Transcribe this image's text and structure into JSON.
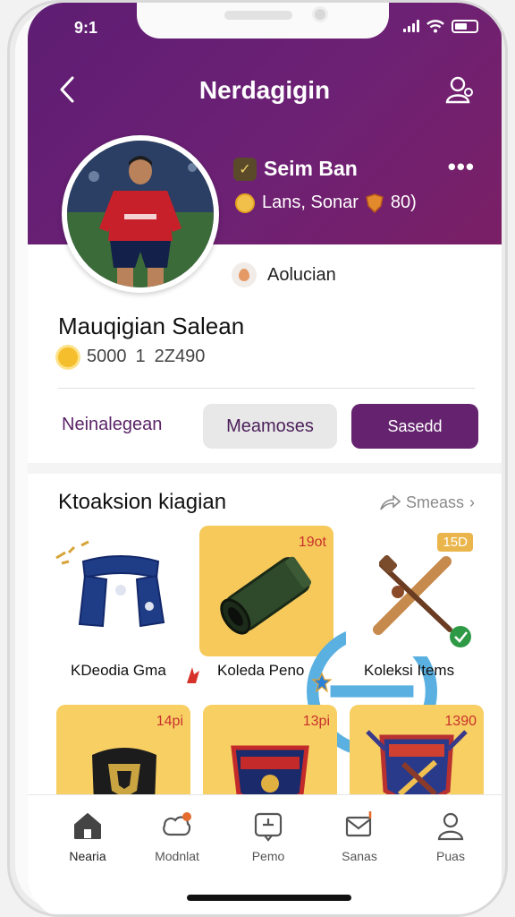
{
  "status": {
    "time": "9:1"
  },
  "header": {
    "title": "Nerdagigin"
  },
  "profile": {
    "username": "Seim Ban",
    "meta_text": "Lans, Sonar",
    "meta_value": "80)",
    "location": "Aolucian",
    "full_name": "Mauqigian Salean",
    "stats_a": "5000",
    "stats_b": "1",
    "stats_c": "2Z490"
  },
  "tabs": {
    "first": "Neinalegean",
    "second": "Meamoses",
    "third": "Sasedd"
  },
  "section": {
    "title": "Ktoaksion kiagian",
    "see_all": "Smeass"
  },
  "items_row1": [
    {
      "label": "KDeodia Gma",
      "price": "",
      "icon": "scarf"
    },
    {
      "label": "Koleda Peno",
      "price": "19ot",
      "icon": "tube"
    },
    {
      "label": "Koleksi Items",
      "price": "15D",
      "icon": "crossed-swords"
    }
  ],
  "items_row2": [
    {
      "price": "14pi",
      "icon": "shield-badge"
    },
    {
      "price": "13pi",
      "icon": "crest"
    },
    {
      "price": "1390",
      "icon": "crest-hammer"
    }
  ],
  "bottom_nav": [
    {
      "label": "Nearia",
      "icon": "home-icon"
    },
    {
      "label": "Modnlat",
      "icon": "store-icon"
    },
    {
      "label": "Pemo",
      "icon": "tablet-icon"
    },
    {
      "label": "Sanas",
      "icon": "mail-icon"
    },
    {
      "label": "Puas",
      "icon": "person-icon"
    }
  ],
  "colors": {
    "header_purple": "#6a2072",
    "accent_purple": "#65226e",
    "card_yellow": "#f6c95a",
    "price_red": "#c8322d"
  }
}
